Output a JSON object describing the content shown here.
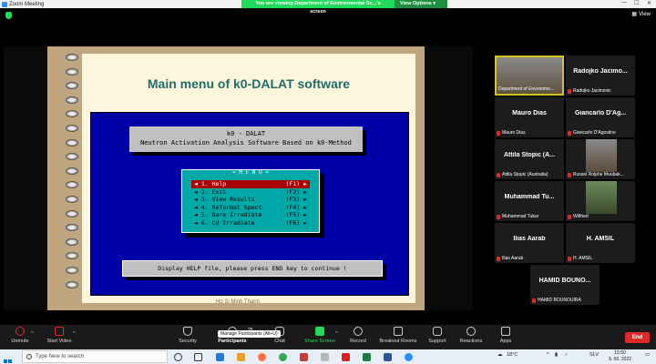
{
  "window": {
    "title": "Zoom Meeting"
  },
  "banner": {
    "message": "You are viewing Department of Environmental Sc...'s screen",
    "options": "View Options"
  },
  "view_label": "View",
  "slide": {
    "title": "Main menu of k0-DALAT software",
    "app_name": "k0 - DALAT",
    "app_subtitle": "Neutron Activation Analysis Software Based on k0-Method",
    "menu_title": "= M E N U =",
    "menu_items": [
      {
        "label": "◄ 1. Help",
        "key": "(F1) ►"
      },
      {
        "label": "◄ 2. Exit",
        "key": "(F2) ►"
      },
      {
        "label": "◄ 3. View Results",
        "key": "(F3) ►"
      },
      {
        "label": "◄ 4. Reformat Spect",
        "key": "(F4) ►"
      },
      {
        "label": "◄ 5. Bare Irradiate",
        "key": "(F5) ►"
      },
      {
        "label": "◄ 6. Cd   Irradiate",
        "key": "(F6) ►"
      }
    ],
    "status": "Display HELP file, please press END key to continue !",
    "footer": "Ho Si Minh Thanh"
  },
  "participants": [
    {
      "name": "",
      "label": "Department of Environme...",
      "video": true
    },
    {
      "name": "Radojko Jacimo...",
      "label": "Radojko Jacimovic"
    },
    {
      "name": "Mauro Dias",
      "label": "Mauro Dias"
    },
    {
      "name": "Giancarlo D'Ag...",
      "label": "Giancarlo D'Agostino"
    },
    {
      "name": "Attila Stopic (A...",
      "label": "Attila Stopic (Australia)"
    },
    {
      "name": "",
      "label": "Russel Rolphe Moubak...",
      "video": true
    },
    {
      "name": "Muhammad Tu...",
      "label": "Muhammad Tukur"
    },
    {
      "name": "",
      "label": "Wilfried",
      "video": true
    },
    {
      "name": "Ilias Aarab",
      "label": "Ilias Aarab"
    },
    {
      "name": "H. AMSIL",
      "label": "H. AMSIL"
    },
    {
      "name": "HAMID BOUNO...",
      "label": "HAMID BOUNOUIRA"
    }
  ],
  "toolbar": {
    "unmute": "Unmute",
    "start_video": "Start Video",
    "security": "Security",
    "participants": "Participants",
    "participants_count": "25",
    "chat": "Chat",
    "share_screen": "Share Screen",
    "record": "Record",
    "breakout": "Breakout Rooms",
    "support": "Support",
    "reactions": "Reactions",
    "apps": "Apps",
    "end": "End",
    "tooltip": "Manage Participants (Alt+U)"
  },
  "taskbar": {
    "search_placeholder": "Type here to search",
    "temperature": "18°C",
    "lang": "SLV",
    "time": "15:50",
    "date": "9. 06. 2022"
  }
}
